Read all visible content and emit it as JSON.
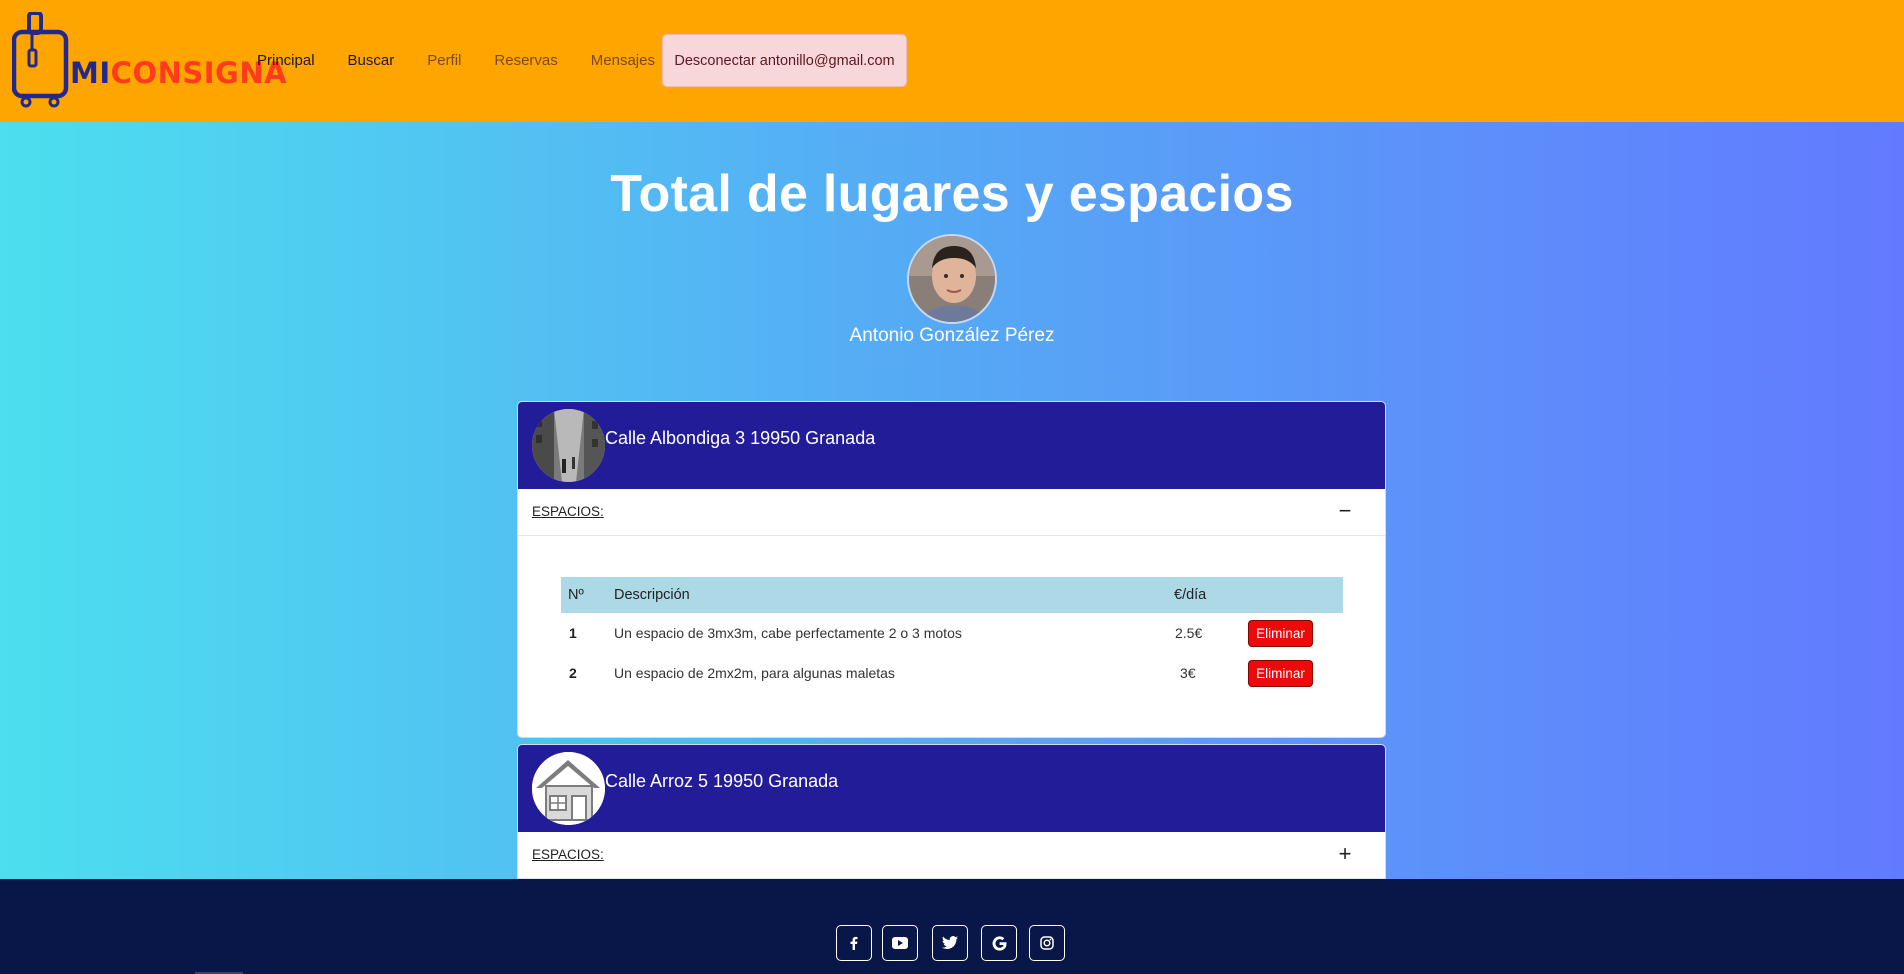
{
  "header": {
    "logo": {
      "mi": "MI",
      "consigna": "CONSIGNA"
    },
    "nav": [
      {
        "label": "Principal"
      },
      {
        "label": "Buscar"
      },
      {
        "label": "Perfil"
      },
      {
        "label": "Reservas"
      },
      {
        "label": "Mensajes"
      }
    ],
    "logout_label": "Desconectar antonillo@gmail.com"
  },
  "main": {
    "title": "Total de lugares y espacios",
    "user_name": "Antonio González Pérez"
  },
  "places": [
    {
      "address": "Calle Albondiga 3 19950 Granada",
      "section_label": "ESPACIOS:",
      "toggle": "−",
      "table": {
        "headers": {
          "num": "Nº",
          "desc": "Descripción",
          "price": "€/día"
        },
        "rows": [
          {
            "num": "1",
            "desc": "Un espacio de 3mx3m, cabe perfectamente 2 o 3 motos",
            "price": "2.5€",
            "action": "Eliminar"
          },
          {
            "num": "2",
            "desc": "Un espacio de 2mx2m, para algunas maletas",
            "price": "3€",
            "action": "Eliminar"
          }
        ]
      }
    },
    {
      "address": "Calle Arroz 5 19950 Granada",
      "section_label": "ESPACIOS:",
      "toggle": "+"
    }
  ],
  "footer": {
    "social": [
      "facebook-icon",
      "youtube-icon",
      "twitter-icon",
      "google-icon",
      "instagram-icon"
    ]
  },
  "colors": {
    "header_bg": "#ffa500",
    "card_head": "#231c99",
    "delete_button": "#ec0a0a",
    "footer_bg": "#081747",
    "table_head": "#add8e6"
  }
}
